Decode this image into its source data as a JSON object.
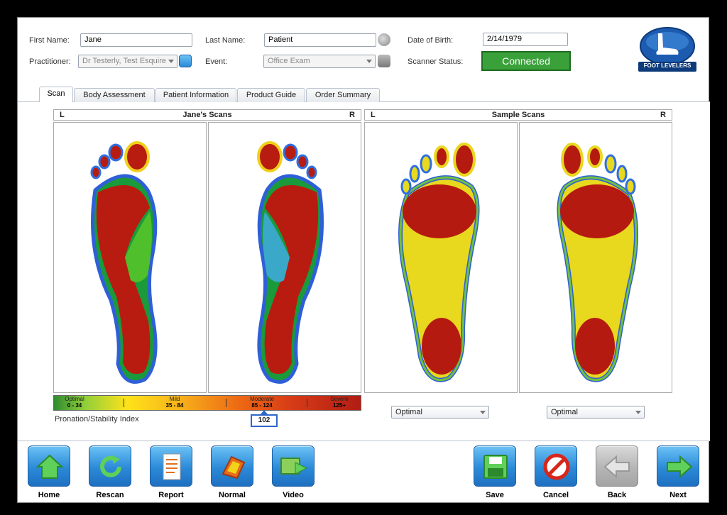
{
  "header": {
    "first_name_label": "First Name:",
    "first_name_value": "Jane",
    "last_name_label": "Last Name:",
    "last_name_value": "Patient",
    "dob_label": "Date of Birth:",
    "dob_value": "2/14/1979",
    "practitioner_label": "Practitioner:",
    "practitioner_value": "Dr Testerly, Test Esquire",
    "event_label": "Event:",
    "event_value": "Office Exam",
    "scanner_status_label": "Scanner Status:",
    "scanner_status_value": "Connected",
    "logo_text": "FOOT LEVELERS"
  },
  "tabs": [
    {
      "label": "Scan",
      "active": true
    },
    {
      "label": "Body  Assessment",
      "active": false
    },
    {
      "label": "Patient Information",
      "active": false
    },
    {
      "label": "Product Guide",
      "active": false
    },
    {
      "label": "Order Summary",
      "active": false
    }
  ],
  "scan": {
    "patient_panel": {
      "title": "Jane's Scans",
      "left_marker": "L",
      "right_marker": "R"
    },
    "sample_panel": {
      "title": "Sample Scans",
      "left_marker": "L",
      "right_marker": "R"
    },
    "scale": [
      {
        "name": "Optimal",
        "range": "0 - 34"
      },
      {
        "name": "Mild",
        "range": "35 - 84"
      },
      {
        "name": "Moderate",
        "range": "85 - 124"
      },
      {
        "name": "Severe",
        "range": "125+"
      }
    ],
    "psi_label": "Pronation/Stability Index",
    "psi_value": "102",
    "sample_left_select": "Optimal",
    "sample_right_select": "Optimal"
  },
  "toolbar": {
    "home": "Home",
    "rescan": "Rescan",
    "report": "Report",
    "normal": "Normal",
    "video": "Video",
    "save": "Save",
    "cancel": "Cancel",
    "back": "Back",
    "next": "Next"
  },
  "colors": {
    "accent_blue": "#2b8ad8",
    "status_green": "#3aa13a",
    "heat_high": "#b01c10",
    "heat_mid": "#f2e21a",
    "heat_low": "#2e6fd8"
  }
}
